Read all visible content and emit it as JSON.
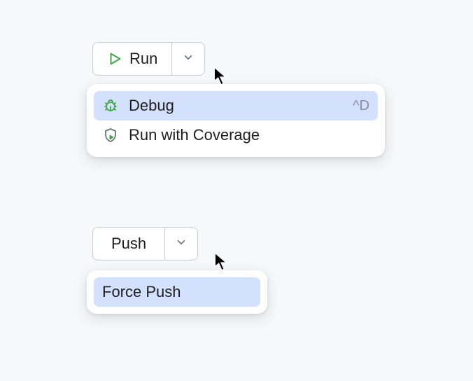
{
  "run_group": {
    "button_label": "Run",
    "menu": [
      {
        "label": "Debug",
        "shortcut": "^D",
        "highlighted": true,
        "icon": "bug-icon"
      },
      {
        "label": "Run with Coverage",
        "shortcut": "",
        "highlighted": false,
        "icon": "coverage-icon"
      }
    ]
  },
  "push_group": {
    "button_label": "Push",
    "menu": [
      {
        "label": "Force Push",
        "highlighted": true
      }
    ]
  }
}
